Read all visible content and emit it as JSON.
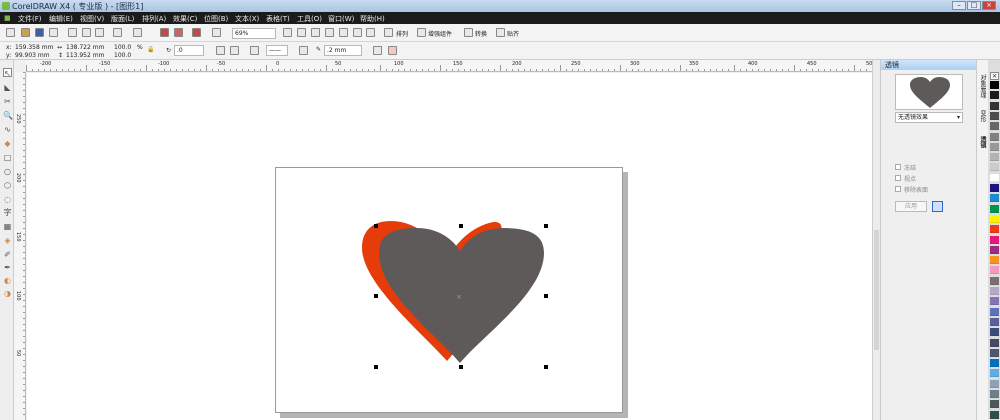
{
  "window": {
    "title": "CorelDRAW X4 ( 专业版 ) - [图形1]"
  },
  "menu": [
    "文件(F)",
    "编辑(E)",
    "视图(V)",
    "版面(L)",
    "排列(A)",
    "效果(C)",
    "位图(B)",
    "文本(X)",
    "表格(T)",
    "工具(O)",
    "窗口(W)",
    "帮助(H)"
  ],
  "toolbar": {
    "zoom": "69%",
    "arrange_label": "排列",
    "weld_label": "增强组件",
    "convert_label": "转换",
    "snap_label": "贴齐"
  },
  "property_bar": {
    "x": "159.358 mm",
    "y": "99.903 mm",
    "width": "138.722 mm",
    "height": "113.952 mm",
    "scale_x": "100.0",
    "scale_y": "100.0",
    "percent": "%",
    "rotation": ".0",
    "outline_width": ".2 mm"
  },
  "rulers": {
    "horizontal": [
      "-200",
      "-150",
      "-100",
      "-50",
      "0",
      "50",
      "100",
      "150",
      "200",
      "250",
      "300",
      "350",
      "400",
      "450",
      "500"
    ],
    "vertical": [
      "250",
      "200",
      "150",
      "100",
      "50"
    ],
    "unit": "毫米"
  },
  "docker": {
    "title": "透镜",
    "lens_type": "无透镜效果",
    "options": [
      "冻结",
      "视点",
      "移除表面"
    ],
    "apply_label": "应用"
  },
  "side_tabs": [
    "对象管理",
    "变形",
    "透镜"
  ],
  "colors": {
    "heart_front": "#5f5a5a",
    "heart_back": "#e63c0a"
  },
  "palette": [
    "#000000",
    "#1a1a1a",
    "#333333",
    "#4d4d4d",
    "#666666",
    "#808080",
    "#999999",
    "#b3b3b3",
    "#cccccc",
    "#ffffff",
    "#1d1480",
    "#1e88d0",
    "#00964b",
    "#fff200",
    "#ee3b14",
    "#e4187a",
    "#9b2c84",
    "#f7941d",
    "#f49ac1",
    "#7b6f6f",
    "#b8a7c9",
    "#8674b5",
    "#5e73b7",
    "#5a5f9e",
    "#3b4d7a",
    "#434a63",
    "#4f5670",
    "#0072bc",
    "#5daee6",
    "#8da3b5",
    "#6e7f8c",
    "#4c5a60",
    "#2f4f4f"
  ]
}
